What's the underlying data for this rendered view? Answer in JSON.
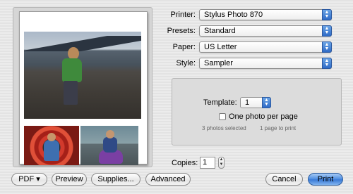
{
  "form": {
    "printer": {
      "label": "Printer:",
      "value": "Stylus Photo 870"
    },
    "presets": {
      "label": "Presets:",
      "value": "Standard"
    },
    "paper": {
      "label": "Paper:",
      "value": "US Letter"
    },
    "style": {
      "label": "Style:",
      "value": "Sampler"
    }
  },
  "options": {
    "template_label": "Template:",
    "template_value": "1",
    "one_photo_label": "One photo per page",
    "photos_selected": "3 photos selected",
    "pages_to_print": "1 page to print"
  },
  "copies": {
    "label": "Copies:",
    "value": "1"
  },
  "buttons": {
    "pdf": "PDF ▾",
    "preview": "Preview",
    "supplies": "Supplies...",
    "advanced": "Advanced",
    "cancel": "Cancel",
    "print": "Print"
  },
  "icons": {
    "popup_arrows": "up-down-arrows-icon",
    "stepper": "stepper-icon"
  },
  "colors": {
    "accent": "#3a7ad6"
  }
}
